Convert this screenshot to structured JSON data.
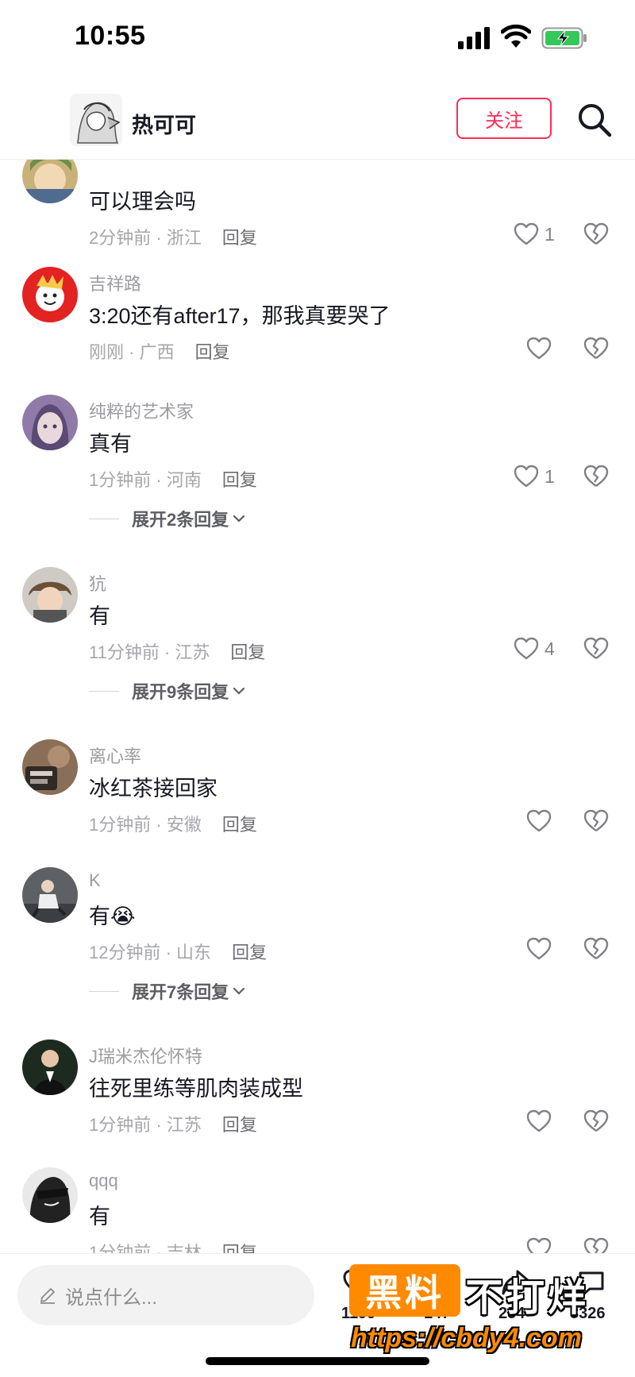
{
  "status_bar": {
    "time": "10:55"
  },
  "header": {
    "author_name": "热可可",
    "follow_label": "关注"
  },
  "comments": [
    {
      "user": "",
      "text": "可以理会吗",
      "time": "2分钟前",
      "location": "浙江",
      "likes": "1",
      "reply_label": "回复"
    },
    {
      "user": "吉祥路",
      "text": "3:20还有after17，那我真要哭了",
      "time": "刚刚",
      "location": "广西",
      "likes": "",
      "reply_label": "回复"
    },
    {
      "user": "纯粹的艺术家",
      "text": "真有",
      "time": "1分钟前",
      "location": "河南",
      "likes": "1",
      "reply_label": "回复",
      "expand": "展开2条回复"
    },
    {
      "user": "犺",
      "text": "有",
      "time": "11分钟前",
      "location": "江苏",
      "likes": "4",
      "reply_label": "回复",
      "expand": "展开9条回复"
    },
    {
      "user": "离心率",
      "text": "冰红茶接回家",
      "time": "1分钟前",
      "location": "安徽",
      "likes": "",
      "reply_label": "回复"
    },
    {
      "user": "K",
      "text": "有😭",
      "time": "12分钟前",
      "location": "山东",
      "likes": "",
      "reply_label": "回复",
      "expand": "展开7条回复"
    },
    {
      "user": "J瑞米杰伦怀特",
      "text": "往死里练等肌肉装成型",
      "time": "1分钟前",
      "location": "江苏",
      "likes": "",
      "reply_label": "回复"
    },
    {
      "user": "qqq",
      "text": "有",
      "time": "1分钟前",
      "location": "吉林",
      "likes": "",
      "reply_label": "回复"
    }
  ],
  "bottom_bar": {
    "input_placeholder": "说点什么...",
    "stats": [
      "1199",
      "147",
      "254",
      "3326"
    ]
  },
  "watermark": {
    "box_text": "黑料",
    "right_text": "不打烊",
    "url": "https://cbdy4.com"
  },
  "colors": {
    "accent": "#fe2c55",
    "watermark_orange": "#ff8a00"
  }
}
